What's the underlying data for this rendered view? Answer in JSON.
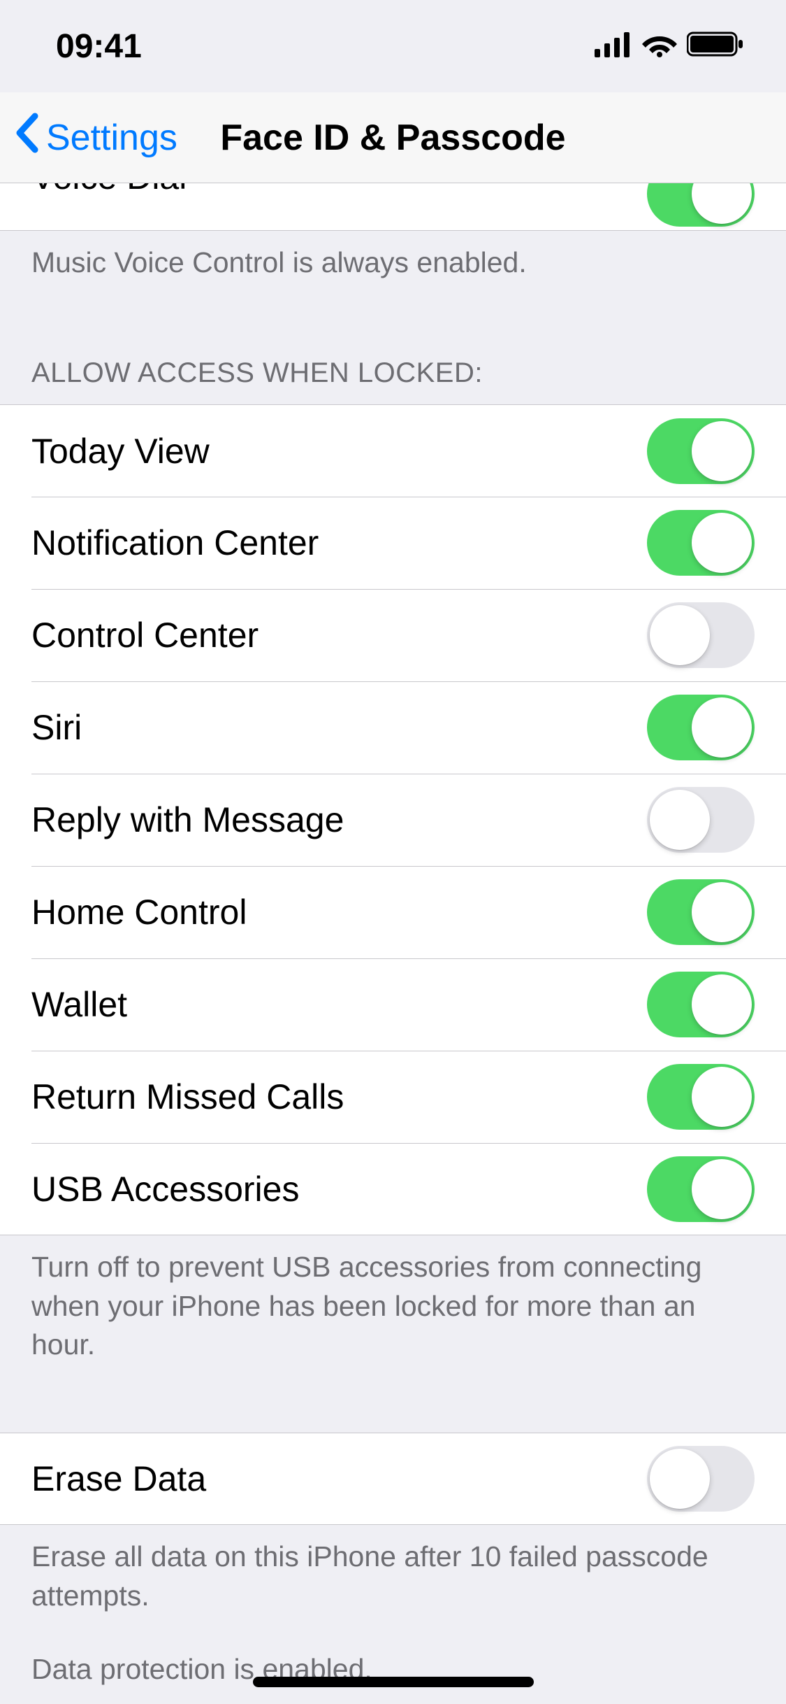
{
  "status": {
    "time": "09:41"
  },
  "nav": {
    "back": "Settings",
    "title": "Face ID & Passcode"
  },
  "voice_dial": {
    "label": "Voice Dial",
    "on": true,
    "footer": "Music Voice Control is always enabled."
  },
  "allow_header": "Allow access when locked:",
  "allow": [
    {
      "label": "Today View",
      "on": true
    },
    {
      "label": "Notification Center",
      "on": true
    },
    {
      "label": "Control Center",
      "on": false
    },
    {
      "label": "Siri",
      "on": true
    },
    {
      "label": "Reply with Message",
      "on": false
    },
    {
      "label": "Home Control",
      "on": true
    },
    {
      "label": "Wallet",
      "on": true
    },
    {
      "label": "Return Missed Calls",
      "on": true
    },
    {
      "label": "USB Accessories",
      "on": true
    }
  ],
  "usb_footer": "Turn off to prevent USB accessories from connecting when your iPhone has been locked for more than an hour.",
  "erase": {
    "label": "Erase Data",
    "on": false,
    "footer1": "Erase all data on this iPhone after 10 failed passcode attempts.",
    "footer2": "Data protection is enabled."
  }
}
